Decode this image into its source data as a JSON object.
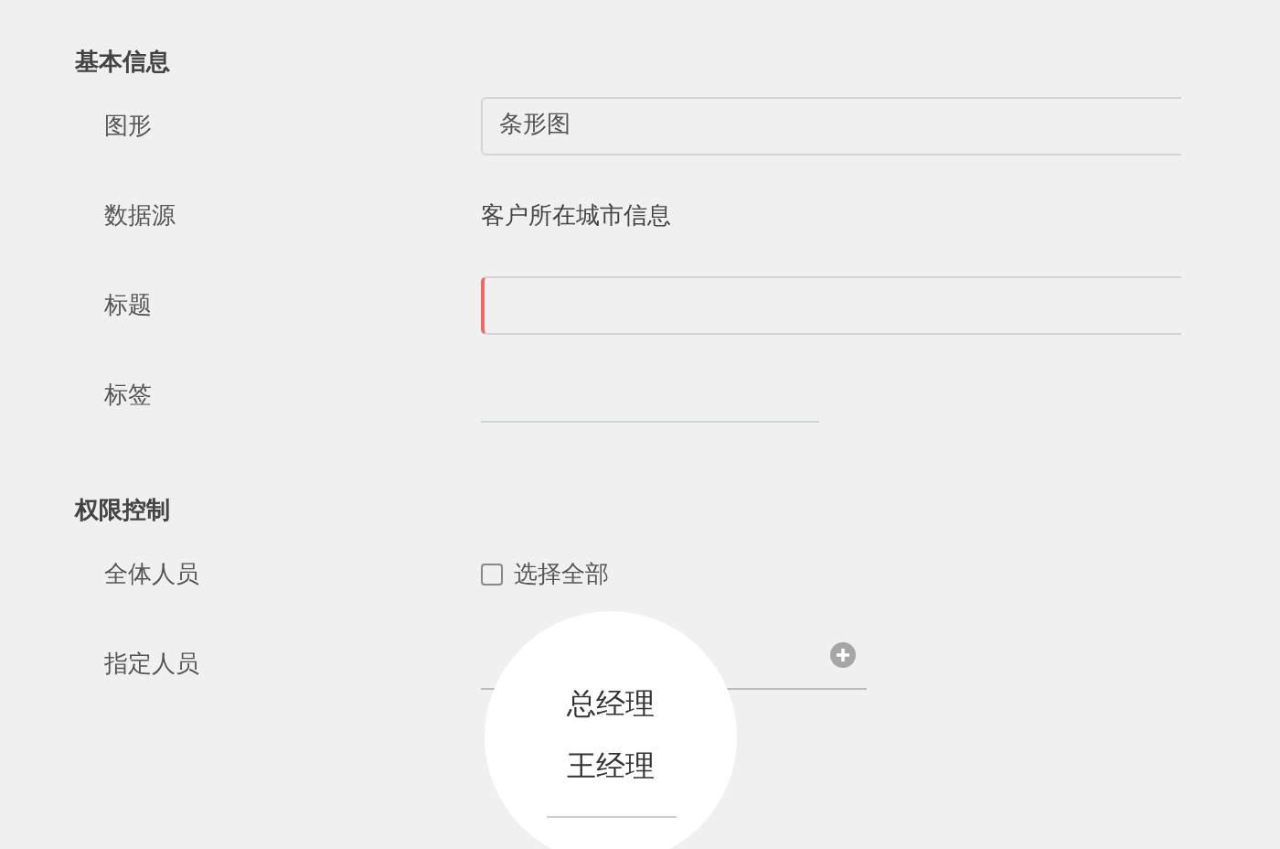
{
  "sections": [
    {
      "title": "基本信息",
      "fields": [
        {
          "kind": "select",
          "label": "图形",
          "value": "条形图"
        },
        {
          "kind": "text",
          "label": "数据源",
          "value": "客户所在城市信息"
        },
        {
          "kind": "input",
          "label": "标题",
          "invalid": true
        },
        {
          "kind": "tags",
          "label": "标签"
        }
      ]
    },
    {
      "title": "权限控制",
      "fields": [
        {
          "kind": "checkbox",
          "label": "全体人员",
          "option": "选择全部",
          "checked": false
        },
        {
          "kind": "picker",
          "label": "指定人员",
          "popup": [
            "总经理",
            "王经理"
          ]
        }
      ]
    }
  ]
}
